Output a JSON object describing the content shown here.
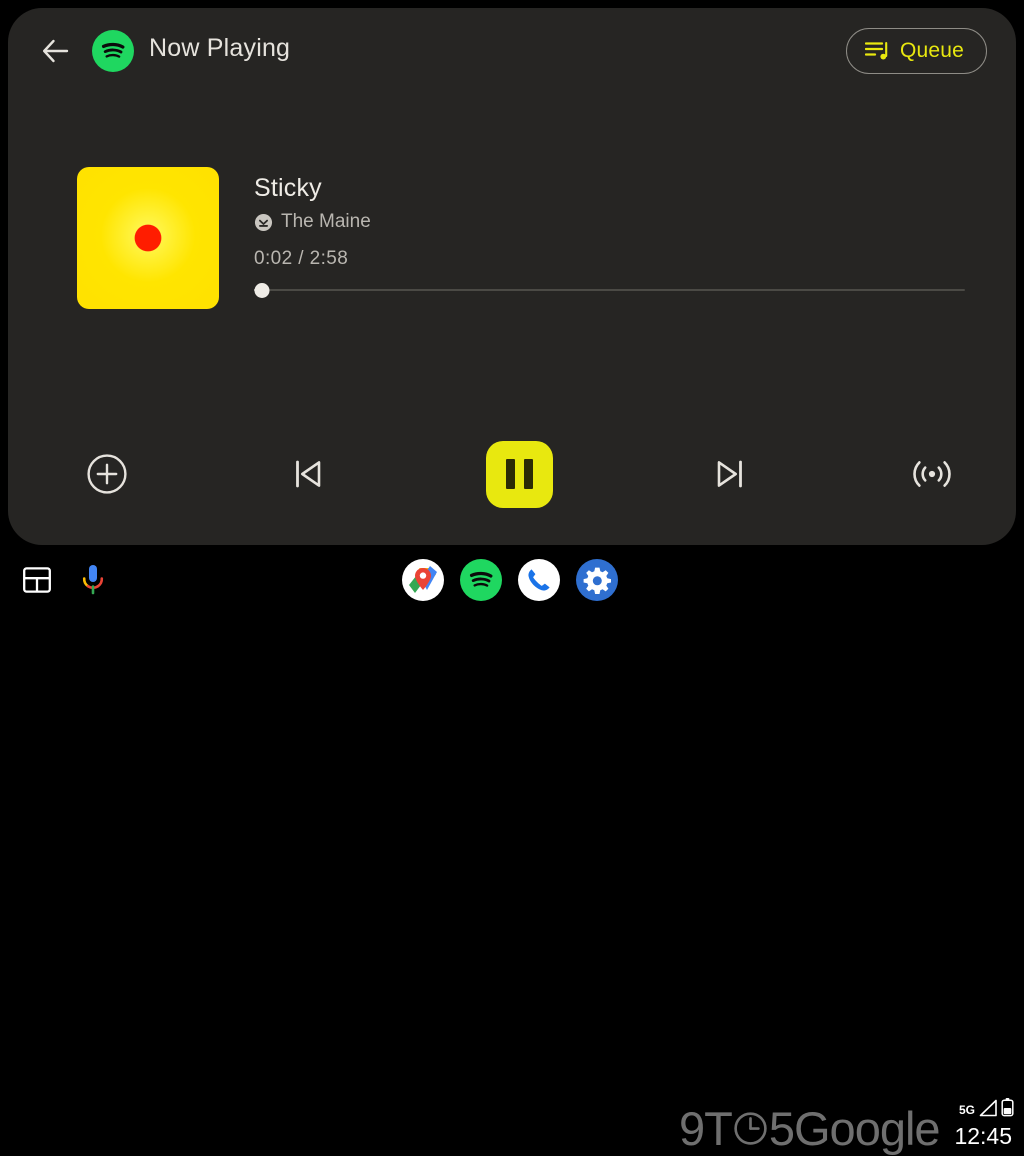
{
  "app": {
    "header": {
      "back_icon": "back-arrow-icon",
      "app_logo": "spotify-logo-icon",
      "title": "Now Playing",
      "queue_button": {
        "label": "Queue",
        "icon": "queue-music-icon",
        "accent_color": "#e8e80f",
        "border_color": "#8e8c86"
      }
    },
    "now_playing": {
      "album_art": {
        "icon": "album-art",
        "background_color": "#ffe500",
        "accent_color": "#ff1d00"
      },
      "track_title": "Sticky",
      "artist_badge_icon": "artist-badge-icon",
      "artist": "The Maine",
      "time_elapsed": "0:02",
      "time_total": "2:58",
      "time_display": "0:02 / 2:58",
      "progress_percent": 1.1
    },
    "controls": [
      {
        "name": "add-to-library-button",
        "icon": "plus-circle-icon"
      },
      {
        "name": "previous-track-button",
        "icon": "skip-previous-icon"
      },
      {
        "name": "play-pause-button",
        "icon": "pause-icon",
        "state": "playing",
        "accent_color": "#e8e80f"
      },
      {
        "name": "next-track-button",
        "icon": "skip-next-icon"
      },
      {
        "name": "connect-device-button",
        "icon": "broadcast-icon"
      }
    ]
  },
  "taskbar": {
    "left_items": [
      {
        "name": "app-grid-button",
        "icon": "grid-icon"
      },
      {
        "name": "assistant-button",
        "icon": "google-assistant-mic-icon"
      }
    ],
    "apps": [
      {
        "name": "maps-app-icon",
        "icon": "google-maps-icon",
        "label": "Maps"
      },
      {
        "name": "spotify-app-icon",
        "icon": "spotify-icon",
        "label": "Spotify"
      },
      {
        "name": "phone-app-icon",
        "icon": "phone-icon",
        "label": "Phone"
      },
      {
        "name": "settings-app-icon",
        "icon": "gear-icon",
        "label": "Settings"
      }
    ],
    "status": {
      "network": "5G",
      "signal_icon": "signal-triangle-icon",
      "battery_icon": "battery-icon",
      "time": "12:45"
    }
  },
  "watermark": {
    "prefix": "9T",
    "clock_icon": "clock-icon",
    "suffix": "5Google"
  }
}
